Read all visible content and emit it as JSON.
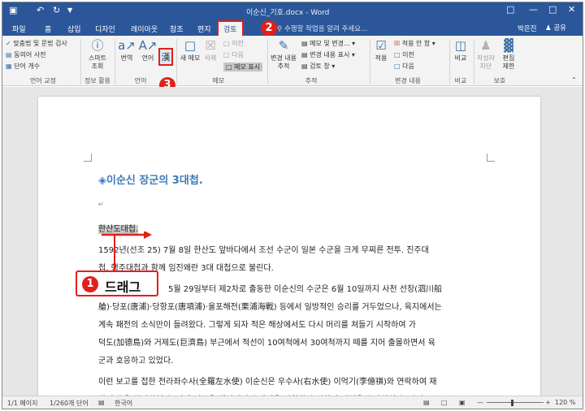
{
  "titlebar": {
    "title": "이순신_기호.docx - Word",
    "save_icon": "save-icon",
    "undo_icon": "undo-icon",
    "redo_icon": "redo-icon"
  },
  "tabs": [
    "파일",
    "홈",
    "삽입",
    "디자인",
    "레이아웃",
    "참조",
    "편지",
    "검토",
    "보기"
  ],
  "active_tab": "검토",
  "tellme": "수행할 작업을 알려 주세요...",
  "user": "박은진",
  "share": "공유",
  "ribbon": {
    "proofing": {
      "spelling": "맞춤법 및 문법 검사",
      "thesaurus": "동의어 사전",
      "wordcount": "단어 개수",
      "group": "언어 교정"
    },
    "insights": {
      "smart": "스마트",
      "lookup": "조회",
      "group": "정보 활용"
    },
    "language": {
      "translate": "번역",
      "lang": "언어",
      "group": "언어"
    },
    "comments": {
      "new": "새 메모",
      "delete": "삭제",
      "prev": "이전",
      "next": "다음",
      "show": "메모 표시",
      "group": "메모"
    },
    "tracking": {
      "track": "변경 내용",
      "track2": "추적",
      "markup": "메모 및 변경...",
      "showmarkup": "변경 내용 표시",
      "pane": "검토 창",
      "group": "추적"
    },
    "changes": {
      "accept": "적용",
      "reject": "적용 안 함",
      "prev": "이전",
      "next": "다음",
      "group": "변경 내용"
    },
    "compare": {
      "label": "비교",
      "group": "비교"
    },
    "protect": {
      "block": "작성자",
      "block2": "차단",
      "restrict": "편집",
      "restrict2": "제한",
      "group": "보호"
    }
  },
  "document": {
    "heading": "◈이순신 장군의 3대첩.",
    "section_title": "한산도대첩.",
    "lines": [
      "1592년(선조 25) 7월 8일 한산도 앞바다에서 조선 수군이 일본 수군을 크게 무찌른 전투. 진주대",
      "첩, 행주대첩과 함께 임진왜란 3대 대첩으로 불린다.",
      "5월 29일부터 제2차로 출동한 이순신의 수군은 6월 10일까지 사천 선창(泗川船",
      "艙)·당포(唐浦)·당항포(唐項浦)·율포해전(栗浦海戰) 등에서 일방적인 승리를 거두었으나, 육지에서는",
      "계속 패전의 소식만이 들려왔다. 그렇게 되자 적은 해상에서도 다시 머리를 쳐들기 시작하여 가",
      "덕도(加德島)와 거제도(巨濟島) 부근에서 적선이 10여척에서 30여척까지 떼를 지어 출몰하면서 육",
      "군과 호응하고 있었다.",
      "이런 보고를 접한 전라좌수사(全羅左水使) 이순신은 우수사(右水使) 이억기(李億祺)와 연락하여 재",
      "차 출동을 결정하였다. 이때 일본은 해상에서의 패전을 만회하기 위하여 병력을 증강하였다. 와키"
    ]
  },
  "status": {
    "page": "1/1 페이지",
    "words": "1/260개 단어",
    "lang": "한국어",
    "zoom": "120 %"
  },
  "annotations": {
    "step1": "1",
    "step1_label": "드래그",
    "step2": "2",
    "step3": "3",
    "color": "#e0201b"
  }
}
